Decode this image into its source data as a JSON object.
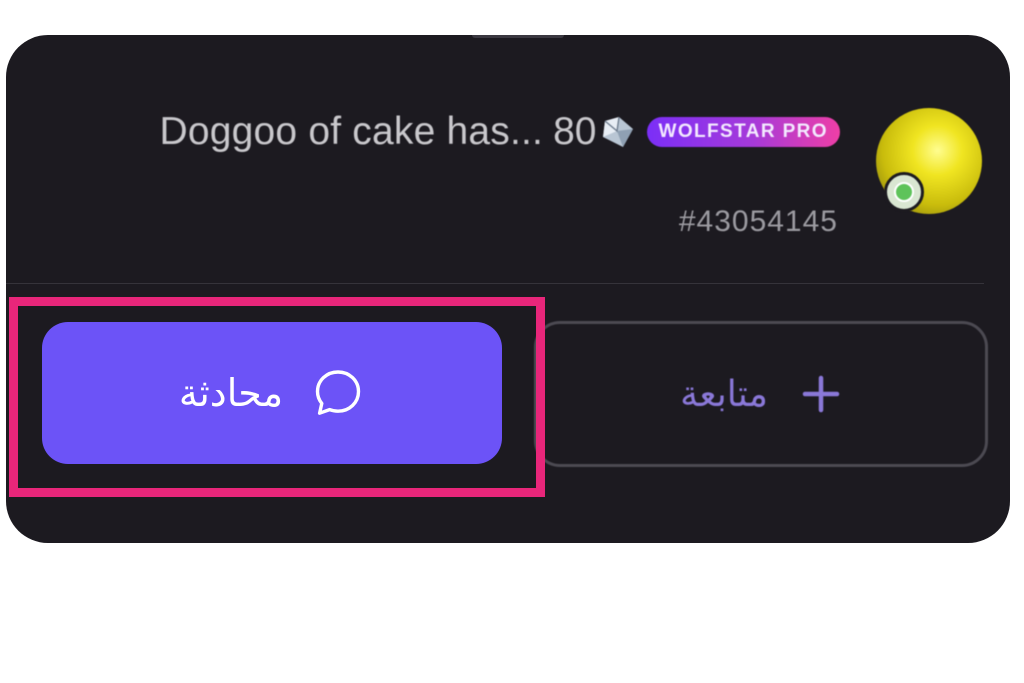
{
  "profile": {
    "name": "Doggoo of cake has...",
    "diamond_count": "80",
    "badge": "WOLFSTAR PRO",
    "user_id": "#43054145",
    "avatar_icon": "avatar-image",
    "status_icon": "online-status-icon"
  },
  "actions": {
    "chat_label": "محادثة",
    "chat_icon": "chat-bubble-icon",
    "follow_label": "متابعة",
    "follow_icon": "plus-icon"
  },
  "colors": {
    "card_background": "#1c1a20",
    "chat_button": "#6c53f7",
    "follow_text": "#8a78d8",
    "highlight": "#e8267a",
    "badge_gradient_start": "#7b2ff7",
    "badge_gradient_end": "#ee3fa6"
  }
}
